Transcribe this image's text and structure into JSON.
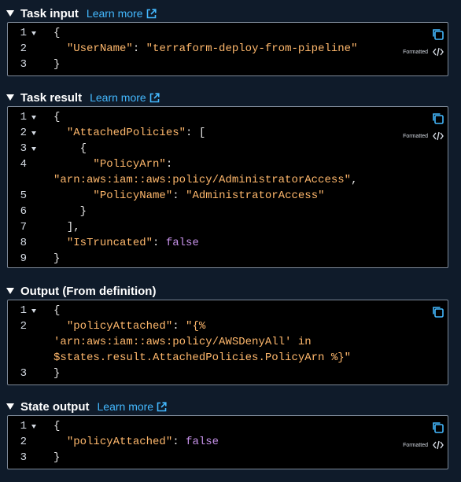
{
  "learn_more": "Learn more",
  "formatted_label": "Formatted",
  "sections": {
    "task_input": {
      "title": "Task input",
      "lines": [
        {
          "n": "1",
          "p": "{"
        },
        {
          "n": "2",
          "k": "\"UserName\"",
          "p": ": ",
          "s": "\"terraform-deploy-from-pipeline\""
        },
        {
          "n": "3",
          "p": "}"
        }
      ]
    },
    "task_result": {
      "title": "Task result",
      "lines": [
        {
          "n": "1",
          "p": "{"
        },
        {
          "n": "2",
          "k": "\"AttachedPolicies\"",
          "p": ": ["
        },
        {
          "n": "3",
          "p": "{"
        },
        {
          "n": "4",
          "k": "\"PolicyArn\"",
          "p": ":"
        },
        {
          "s": "\"arn:aws:iam::aws:policy/AdministratorAccess\"",
          "p": ","
        },
        {
          "n": "5",
          "k": "\"PolicyName\"",
          "p": ": ",
          "s": "\"AdministratorAccess\""
        },
        {
          "n": "6",
          "p": "}"
        },
        {
          "n": "7",
          "p": "],"
        },
        {
          "n": "8",
          "k": "\"IsTruncated\"",
          "p": ": ",
          "b": "false"
        },
        {
          "n": "9",
          "p": "}"
        }
      ]
    },
    "output": {
      "title": "Output (From definition)",
      "lines": [
        {
          "n": "1",
          "p": "{"
        },
        {
          "n": "2",
          "k": "\"policyAttached\"",
          "p": ": ",
          "s": "\"{%"
        },
        {
          "s": "'arn:aws:iam::aws:policy/AWSDenyAll' in"
        },
        {
          "s": "$states.result.AttachedPolicies.PolicyArn %}\""
        },
        {
          "n": "3",
          "p": "}"
        }
      ]
    },
    "state_output": {
      "title": "State output",
      "lines": [
        {
          "n": "1",
          "p": "{"
        },
        {
          "n": "2",
          "k": "\"policyAttached\"",
          "p": ": ",
          "b": "false"
        },
        {
          "n": "3",
          "p": "}"
        }
      ]
    }
  }
}
